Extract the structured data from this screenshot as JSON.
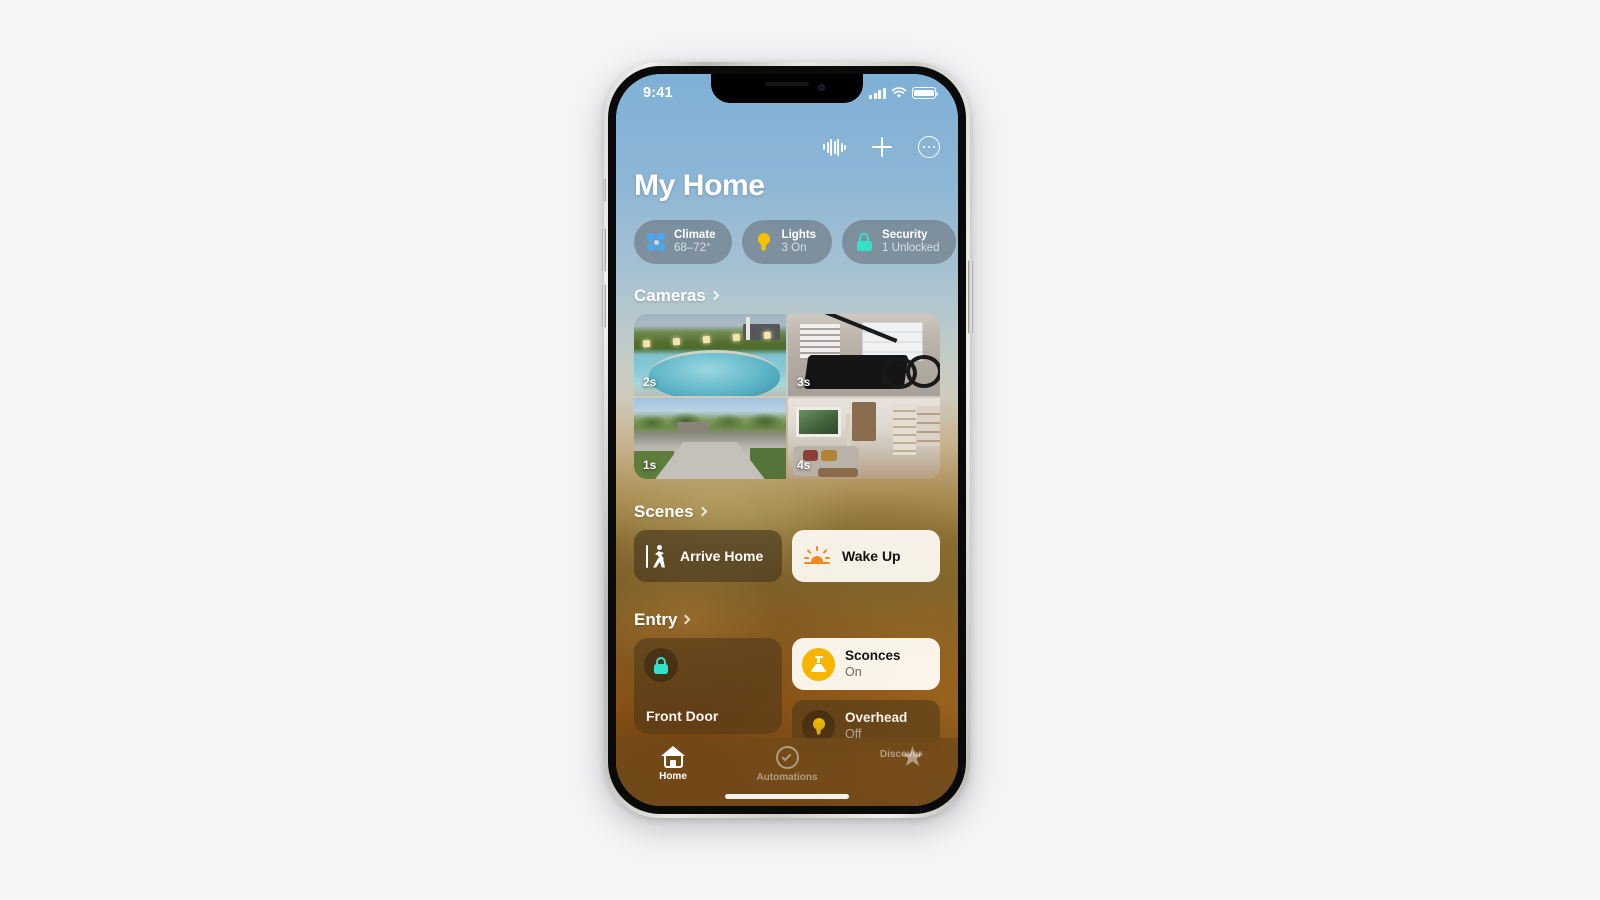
{
  "status_bar": {
    "time": "9:41",
    "cellular_icon": "signal-bars-icon",
    "wifi_icon": "wifi-icon",
    "battery_icon": "battery-icon"
  },
  "toolbar": {
    "siri_waveform_label": "siri-waveform",
    "add_label": "add",
    "more_label": "more"
  },
  "header": {
    "title": "My Home"
  },
  "status_pills": [
    {
      "name": "Climate",
      "value": "68–72°",
      "icon": "fan-icon",
      "color": "#4aa8f0"
    },
    {
      "name": "Lights",
      "value": "3 On",
      "icon": "bulb-icon",
      "color": "#f6c200"
    },
    {
      "name": "Security",
      "value": "1 Unlocked",
      "icon": "lock-icon",
      "color": "#35e0c8"
    }
  ],
  "sections": {
    "cameras": {
      "title": "Cameras",
      "tiles": [
        {
          "name": "Pool Camera",
          "badge": "2s"
        },
        {
          "name": "Garage Camera",
          "badge": "3s"
        },
        {
          "name": "Driveway Camera",
          "badge": "1s"
        },
        {
          "name": "Living Room Camera",
          "badge": "4s"
        }
      ]
    },
    "scenes": {
      "title": "Scenes",
      "tiles": [
        {
          "name": "Arrive Home",
          "icon": "walk-through-door-icon",
          "state": "off"
        },
        {
          "name": "Wake Up",
          "icon": "sunrise-icon",
          "state": "on"
        }
      ]
    },
    "entry": {
      "title": "Entry",
      "big_tile": {
        "name": "Front Door",
        "icon": "lock-icon",
        "accent": "#35e0c8"
      },
      "small_tiles": [
        {
          "name": "Sconces",
          "state": "On",
          "icon": "sconce-icon",
          "accent": "#f5b500"
        },
        {
          "name": "Overhead",
          "state": "Off",
          "icon": "bulb-icon",
          "accent": "#f5b500"
        }
      ]
    }
  },
  "tab_bar": [
    {
      "label": "Home",
      "icon": "house-icon",
      "active": true
    },
    {
      "label": "Automations",
      "icon": "clock-check-icon",
      "active": false
    },
    {
      "label": "Discover",
      "icon": "star-icon",
      "active": false
    }
  ]
}
